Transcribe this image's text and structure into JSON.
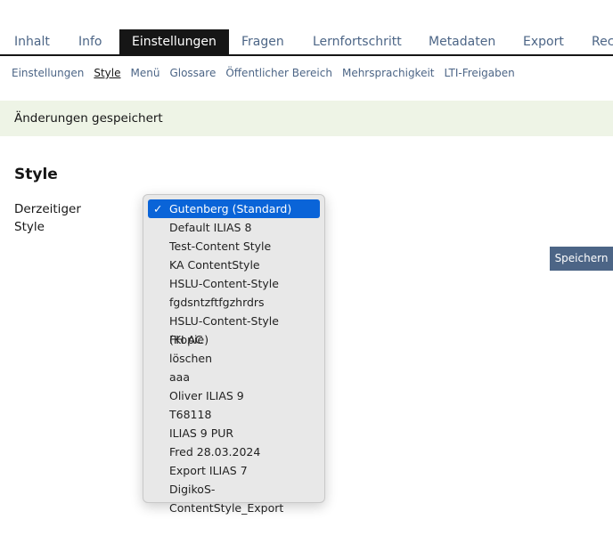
{
  "tabs": [
    {
      "label": "Inhalt"
    },
    {
      "label": "Info"
    },
    {
      "label": "Einstellungen",
      "active": true
    },
    {
      "label": "Fragen"
    },
    {
      "label": "Lernfortschritt"
    },
    {
      "label": "Metadaten"
    },
    {
      "label": "Export"
    },
    {
      "label": "Rec"
    }
  ],
  "subtabs": [
    {
      "label": "Einstellungen"
    },
    {
      "label": "Style",
      "active": true
    },
    {
      "label": "Menü"
    },
    {
      "label": "Glossare"
    },
    {
      "label": "Öffentlicher Bereich"
    },
    {
      "label": "Mehrsprachigkeit"
    },
    {
      "label": "LTI-Freigaben"
    }
  ],
  "message": "Änderungen gespeichert",
  "section_title": "Style",
  "field_label": "Derzeitiger Style",
  "save_label": "Speichern",
  "dropdown": {
    "selected": "Gutenberg (Standard)",
    "check": "✓",
    "options": [
      "Gutenberg (Standard)",
      "Default ILIAS 8",
      "Test-Content Style",
      "KA ContentStyle",
      "HSLU-Content-Style",
      "fgdsntzftfgzhrdrs",
      "HSLU-Content-Style (Kopie)",
      "FH AC",
      "löschen",
      "aaa",
      "Oliver ILIAS 9",
      "T68118",
      "ILIAS 9 PUR",
      "Fred 28.03.2024",
      "Export ILIAS 7",
      "DigikoS-ContentStyle_Export"
    ]
  },
  "colors": {
    "accent": "#4c6586",
    "success_bg": "#eef4e6",
    "selection": "#0a64d8"
  }
}
